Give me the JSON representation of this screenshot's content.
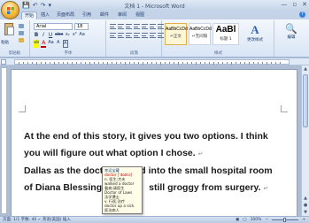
{
  "window": {
    "title": "文档 1 - Microsoft Word",
    "quick_access": [
      "💾",
      "↶",
      "↷",
      "▾"
    ],
    "controls": [
      "—",
      "▫",
      "✕"
    ]
  },
  "tabs": [
    {
      "label": "开始",
      "active": true
    },
    {
      "label": "插入",
      "active": false
    },
    {
      "label": "页面布局",
      "active": false
    },
    {
      "label": "引用",
      "active": false
    },
    {
      "label": "邮件",
      "active": false
    },
    {
      "label": "审阅",
      "active": false
    },
    {
      "label": "视图",
      "active": false
    }
  ],
  "ribbon": {
    "clipboard": {
      "paste_label": "粘贴",
      "group_label": "剪贴板"
    },
    "font": {
      "font_name": "Arial",
      "font_size": "18",
      "format_buttons": [
        "B",
        "I",
        "U",
        "abe",
        "x₂",
        "x²",
        "Aa"
      ],
      "color_buttons": [
        "ab",
        "A",
        "Aa",
        "A",
        "A"
      ],
      "group_label": "字体"
    },
    "paragraph": {
      "group_label": "段落"
    },
    "styles": {
      "items": [
        {
          "sample": "AaBbCcDd",
          "name": "↵正文"
        },
        {
          "sample": "AaBbCcDd",
          "name": "↵无间隔"
        },
        {
          "sample": "AaBl",
          "name": "标题 1"
        }
      ],
      "change_styles_label": "更改样式",
      "group_label": "样式"
    },
    "editing": {
      "label": "编辑"
    }
  },
  "document": {
    "lines": [
      "At the end of this story, it gives you two options. I think",
      "you will figure out what option I chose.",
      "Dallas as the doctor walked into the small hospital room",
      "of Diana Blessing",
      "still groggy from surgery."
    ]
  },
  "ime_popup": {
    "lines": [
      "幸运宝藏",
      "doctor [ˈdɒktə]",
      "n. 医生;大夫",
      "walked a doctor",
      "看病;请医生",
      "Doctor of Laws",
      "法学博士",
      "v. 行医;治疗",
      "doctor up a sick",
      "医治病人"
    ]
  },
  "status": {
    "left": "页面: 1/1   字数: 40   ✓ 英语(美国)   插入",
    "zoom": "100%"
  },
  "colors": {
    "accent": "#2f64b0",
    "chrome": "#c4d3e8",
    "ime_background": "#fffde7"
  }
}
